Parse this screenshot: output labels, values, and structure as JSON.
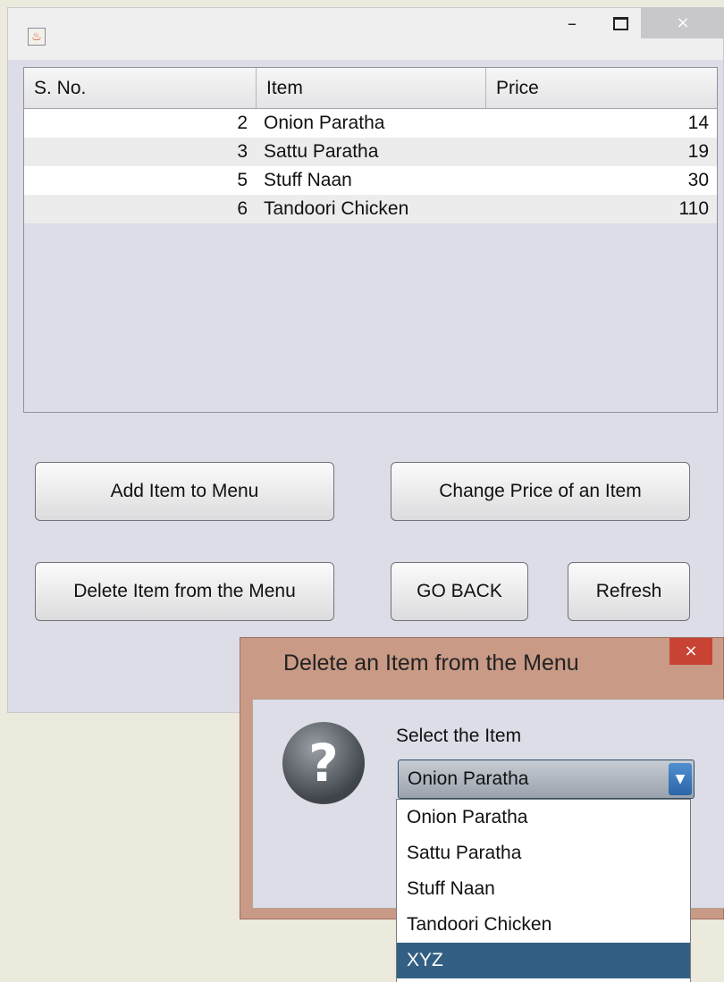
{
  "window": {
    "controls": {
      "minimize": "–",
      "close": "×"
    }
  },
  "table": {
    "columns": [
      "S. No.",
      "Item",
      "Price"
    ],
    "rows": [
      {
        "sno": "2",
        "item": "Onion Paratha",
        "price": "14"
      },
      {
        "sno": "3",
        "item": "Sattu Paratha",
        "price": "19"
      },
      {
        "sno": "5",
        "item": "Stuff Naan",
        "price": "30"
      },
      {
        "sno": "6",
        "item": "Tandoori Chicken",
        "price": "110"
      }
    ]
  },
  "buttons": {
    "add_item": "Add Item to Menu",
    "change_price": "Change Price of an Item",
    "delete_item": "Delete Item from the Menu",
    "go_back": "GO BACK",
    "refresh": "Refresh"
  },
  "dialog": {
    "title": "Delete an Item from the Menu",
    "close": "×",
    "icon": "question-icon",
    "icon_glyph": "?",
    "label": "Select the Item",
    "selected_value": "Onion Paratha",
    "arrow": "▼",
    "options": [
      "Onion Paratha",
      "Sattu Paratha",
      "Stuff Naan",
      "Tandoori Chicken",
      "XYZ"
    ],
    "highlighted_option": "XYZ"
  },
  "colors": {
    "dialog_frame": "#c99a86",
    "dialog_close": "#c84334",
    "highlight": "#335f84",
    "window_bg": "#dcdde6"
  }
}
